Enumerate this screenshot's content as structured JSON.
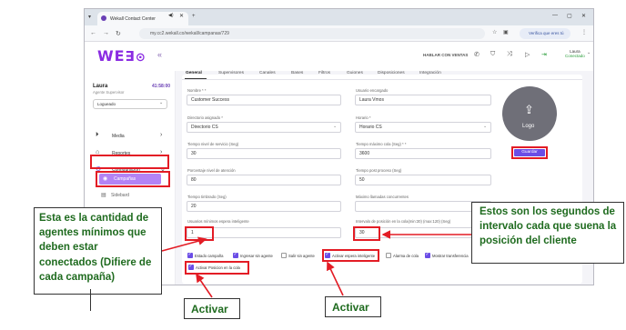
{
  "browser": {
    "tab_title": "Wekall Contact Center",
    "url": "my.cc2.wekall.co/wekall/campanas/729",
    "verify_label": "Verifica que eres tú"
  },
  "header": {
    "logo_text": "WE",
    "hablar_label": "HABLAR CON VENTAS",
    "user_name": "Laura",
    "user_status": "Conectado"
  },
  "sidebar": {
    "agent_name": "Laura",
    "agent_time": "41:58:00",
    "agent_role": "Agente Supervisor",
    "status_value": "Logueado",
    "items": [
      {
        "label": "Media"
      },
      {
        "label": "Reportes"
      },
      {
        "label": "Configuración"
      }
    ],
    "sub_active": "Campañas",
    "sub_next": "Sidebard"
  },
  "tabs": [
    "General",
    "Supervisores",
    "Canales",
    "Bases",
    "Filtros",
    "Guiones",
    "Disposiciones",
    "Integración"
  ],
  "form": {
    "nombre_label": "Nombre * *",
    "nombre_value": "Customer Success",
    "usuario_label": "Usuario encargado",
    "usuario_value": "Laura Vmos",
    "directorio_label": "Directorio asignado *",
    "directorio_value": "Directorio CS",
    "horario_label": "Horario *",
    "horario_value": "Horario CS",
    "tiempo_servicio_label": "Tiempo nivel de servicio (Seg)",
    "tiempo_servicio_value": "30",
    "tiempo_cola_label": "Tiempo máximo cola (Seg) * *",
    "tiempo_cola_value": "3600",
    "porcentaje_label": "Porcentaje nivel de atención",
    "porcentaje_value": "80",
    "post_proceso_label": "Tiempo post proceso (Seg)",
    "post_proceso_value": "50",
    "timbrado_label": "Tiempo timbrado (Seg)",
    "timbrado_value": "20",
    "max_llamadas_label": "Máximo llamadas concurrentes",
    "usuarios_min_label": "Usuarios mínimos espera inteligente",
    "usuarios_min_value": "1",
    "intervalo_label": "Intervalo de posición en la cola(min:30) (max:120) (Seg)",
    "intervalo_value": "30"
  },
  "checkboxes": [
    {
      "label": "Estado campaña",
      "checked": true
    },
    {
      "label": "Ingresar sin agente",
      "checked": true
    },
    {
      "label": "Salir sin agente",
      "checked": false
    },
    {
      "label": "Activar espera inteligente",
      "checked": true
    },
    {
      "label": "Alarma de cola",
      "checked": false
    },
    {
      "label": "Mostrar transferencia",
      "checked": true
    },
    {
      "label": "Activar Posicion en la cola",
      "checked": true
    }
  ],
  "logo_box": {
    "label": "Logo",
    "save_label": "Guardar"
  },
  "annotations": {
    "left": "Esta es la cantidad de agentes mínimos que deben estar conectados (Difiere de cada campaña)",
    "right": "Estos son los segundos de intervalo cada que suena la posición del cliente",
    "activar_1": "Activar",
    "activar_2": "Activar"
  },
  "colors": {
    "accent": "#6b4de6",
    "highlight": "#e31c25",
    "annotation_text": "#1f6b1f"
  }
}
